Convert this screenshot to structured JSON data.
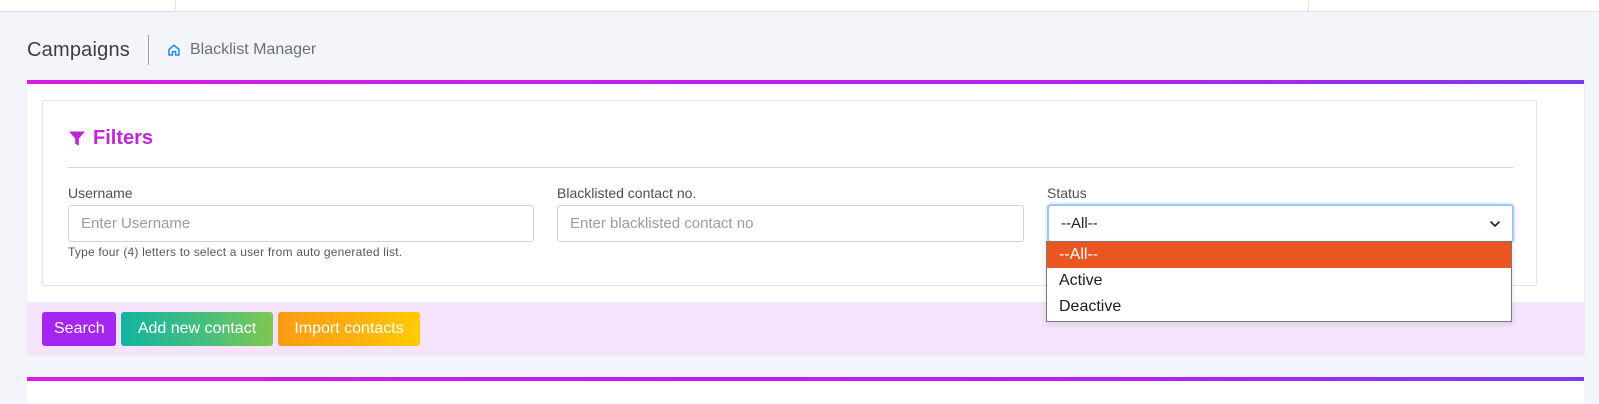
{
  "header": {
    "page_title": "Campaigns",
    "breadcrumb": "Blacklist Manager"
  },
  "filters": {
    "title": "Filters",
    "username": {
      "label": "Username",
      "placeholder": "Enter Username",
      "helper": "Type four (4) letters to select a user from auto generated list."
    },
    "contact": {
      "label": "Blacklisted contact no.",
      "placeholder": "Enter blacklisted contact no"
    },
    "status": {
      "label": "Status",
      "selected": "--All--",
      "options": [
        "--All--",
        "Active",
        "Deactive"
      ]
    }
  },
  "actions": {
    "search_label": "Search",
    "add_label": "Add new contact",
    "import_label": "Import contacts"
  },
  "colors": {
    "accent": "#c026d3",
    "selected_option": "#ea5522",
    "action_bar": "#f5e3fb"
  },
  "icons": {
    "home": "home-icon",
    "filter": "filter-icon",
    "chevron": "chevron-down-icon"
  }
}
